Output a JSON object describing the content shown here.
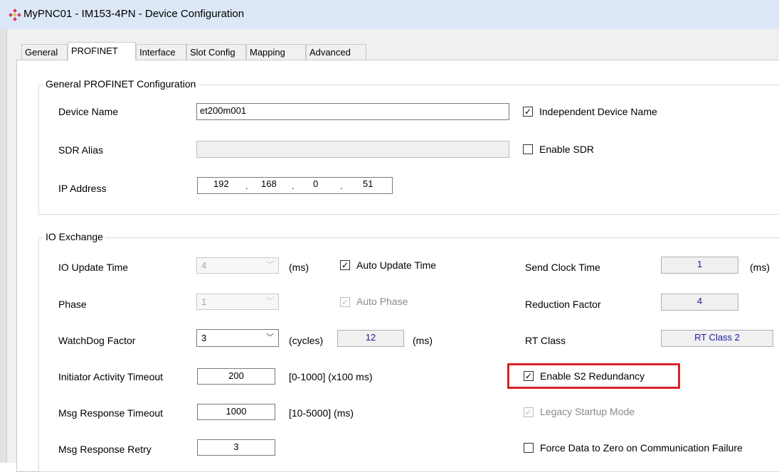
{
  "window": {
    "title": "MyPNC01 - IM153-4PN - Device Configuration",
    "icon": "profinet-logo-icon"
  },
  "tabs": [
    "General",
    "PROFINET",
    "Interface",
    "Slot Config",
    "Mapping",
    "Advanced"
  ],
  "active_tab": "PROFINET",
  "general_group": {
    "title": "General PROFINET Configuration",
    "device_name_label": "Device Name",
    "device_name_value": "et200m001",
    "independent_device_name_label": "Independent Device Name",
    "independent_device_name_checked": true,
    "sdr_alias_label": "SDR Alias",
    "sdr_alias_value": "",
    "enable_sdr_label": "Enable SDR",
    "enable_sdr_checked": false,
    "ip_address_label": "IP Address",
    "ip_octets": [
      "192",
      "168",
      "0",
      "51"
    ]
  },
  "io_group": {
    "title": "IO Exchange",
    "io_update_time_label": "IO Update Time",
    "io_update_time_value": "4",
    "io_update_time_unit": "(ms)",
    "auto_update_time_label": "Auto Update Time",
    "auto_update_time_checked": true,
    "send_clock_time_label": "Send Clock Time",
    "send_clock_time_value": "1",
    "send_clock_time_unit": "(ms)",
    "phase_label": "Phase",
    "phase_value": "1",
    "auto_phase_label": "Auto Phase",
    "auto_phase_checked": true,
    "reduction_factor_label": "Reduction Factor",
    "reduction_factor_value": "4",
    "watchdog_factor_label": "WatchDog Factor",
    "watchdog_factor_value": "3",
    "watchdog_cycles_unit": "(cycles)",
    "watchdog_time_value": "12",
    "watchdog_time_unit": "(ms)",
    "rt_class_label": "RT Class",
    "rt_class_value": "RT Class 2",
    "initiator_timeout_label": "Initiator Activity Timeout",
    "initiator_timeout_value": "200",
    "initiator_timeout_range": "[0-1000] (x100 ms)",
    "enable_s2_label": "Enable S2 Redundancy",
    "enable_s2_checked": true,
    "highlight_color": "#d9222a",
    "msg_response_timeout_label": "Msg Response Timeout",
    "msg_response_timeout_value": "1000",
    "msg_response_timeout_range": "[10-5000] (ms)",
    "legacy_startup_label": "Legacy Startup Mode",
    "legacy_startup_checked": true,
    "msg_response_retry_label": "Msg Response Retry",
    "msg_response_retry_value": "3",
    "force_zero_label": "Force Data to Zero on Communication Failure",
    "force_zero_checked": false
  },
  "colors": {
    "titlebar": "#dce8f7",
    "readonly_value": "#1a1aa0",
    "logo": "#e0316e"
  }
}
